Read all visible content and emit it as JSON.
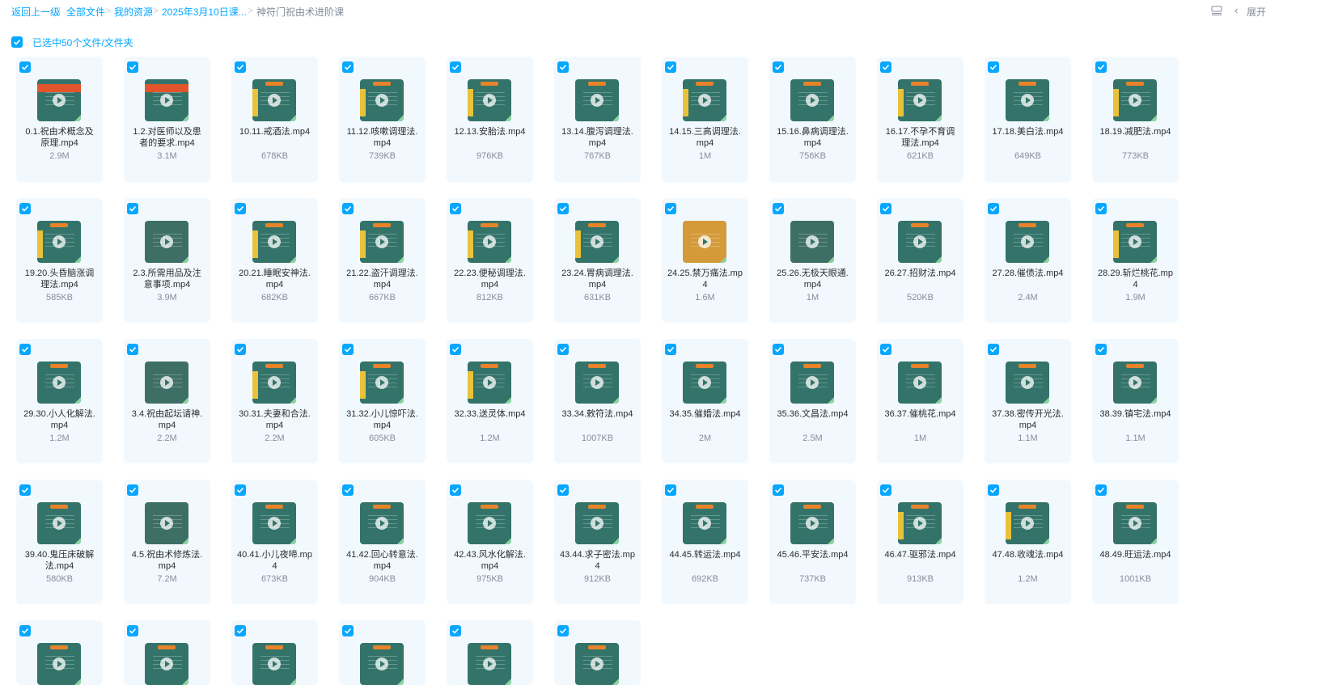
{
  "breadcrumb": {
    "back": "返回上一级",
    "items": [
      "全部文件",
      "我的资源",
      "2025年3月10日课...",
      "神符门祝由术进阶课"
    ]
  },
  "top_right": {
    "list_icon": "list-view-icon",
    "collapse": "展开"
  },
  "selection": {
    "label": "已选中50个文件/文件夹"
  },
  "accent_color": "#06a7ff",
  "files": [
    {
      "name": "0.1.祝由术概念及原理.mp4",
      "size": "2.9M",
      "thumb": "red"
    },
    {
      "name": "1.2.对医师以及患者的要求.mp4",
      "size": "3.1M",
      "thumb": "red"
    },
    {
      "name": "10.11.戒酒法.mp4",
      "size": "678KB",
      "thumb": "strip"
    },
    {
      "name": "11.12.咳嗽调理法.mp4",
      "size": "739KB",
      "thumb": "strip"
    },
    {
      "name": "12.13.安胎法.mp4",
      "size": "976KB",
      "thumb": "strip"
    },
    {
      "name": "13.14.腹泻调理法.mp4",
      "size": "767KB",
      "thumb": "plain"
    },
    {
      "name": "14.15.三高调理法.mp4",
      "size": "1M",
      "thumb": "strip"
    },
    {
      "name": "15.16.鼻病调理法.mp4",
      "size": "756KB",
      "thumb": "plain"
    },
    {
      "name": "16.17.不孕不育调理法.mp4",
      "size": "621KB",
      "thumb": "strip"
    },
    {
      "name": "17.18.美白法.mp4",
      "size": "649KB",
      "thumb": "plain"
    },
    {
      "name": "18.19.减肥法.mp4",
      "size": "773KB",
      "thumb": "strip"
    },
    {
      "name": "19.20.头昏脑涨调理法.mp4",
      "size": "585KB",
      "thumb": "strip"
    },
    {
      "name": "2.3.所需用品及注意事项.mp4",
      "size": "3.9M",
      "thumb": "ttl"
    },
    {
      "name": "20.21.睡眠安神法.mp4",
      "size": "682KB",
      "thumb": "strip"
    },
    {
      "name": "21.22.盗汗调理法.mp4",
      "size": "667KB",
      "thumb": "strip"
    },
    {
      "name": "22.23.便秘调理法.mp4",
      "size": "812KB",
      "thumb": "strip"
    },
    {
      "name": "23.24.胃病调理法.mp4",
      "size": "631KB",
      "thumb": "strip"
    },
    {
      "name": "24.25.禁万痛法.mp4",
      "size": "1.6M",
      "thumb": "pic"
    },
    {
      "name": "25.26.无极天眼通.mp4",
      "size": "1M",
      "thumb": "ttl"
    },
    {
      "name": "26.27.招财法.mp4",
      "size": "520KB",
      "thumb": "plain"
    },
    {
      "name": "27.28.催债法.mp4",
      "size": "2.4M",
      "thumb": "plain"
    },
    {
      "name": "28.29.斩烂桃花.mp4",
      "size": "1.9M",
      "thumb": "strip"
    },
    {
      "name": "29.30.小人化解法.mp4",
      "size": "1.2M",
      "thumb": "plain"
    },
    {
      "name": "3.4.祝由起坛请神.mp4",
      "size": "2.2M",
      "thumb": "ttl"
    },
    {
      "name": "30.31.夫妻和合法.mp4",
      "size": "2.2M",
      "thumb": "strip"
    },
    {
      "name": "31.32.小儿惊吓法.mp4",
      "size": "605KB",
      "thumb": "strip"
    },
    {
      "name": "32.33.送灵体.mp4",
      "size": "1.2M",
      "thumb": "strip"
    },
    {
      "name": "33.34.敕符法.mp4",
      "size": "1007KB",
      "thumb": "plain"
    },
    {
      "name": "34.35.催婚法.mp4",
      "size": "2M",
      "thumb": "plain"
    },
    {
      "name": "35.36.文昌法.mp4",
      "size": "2.5M",
      "thumb": "plain"
    },
    {
      "name": "36.37.催桃花.mp4",
      "size": "1M",
      "thumb": "plain"
    },
    {
      "name": "37.38.密传开光法.mp4",
      "size": "1.1M",
      "thumb": "plain"
    },
    {
      "name": "38.39.镇宅法.mp4",
      "size": "1.1M",
      "thumb": "plain"
    },
    {
      "name": "39.40.鬼压床破解法.mp4",
      "size": "580KB",
      "thumb": "plain"
    },
    {
      "name": "4.5.祝由术修炼法.mp4",
      "size": "7.2M",
      "thumb": "ttl"
    },
    {
      "name": "40.41.小儿夜啼.mp4",
      "size": "673KB",
      "thumb": "plain"
    },
    {
      "name": "41.42.回心转意法.mp4",
      "size": "904KB",
      "thumb": "plain"
    },
    {
      "name": "42.43.风水化解法.mp4",
      "size": "975KB",
      "thumb": "plain"
    },
    {
      "name": "43.44.求子密法.mp4",
      "size": "912KB",
      "thumb": "plain"
    },
    {
      "name": "44.45.转运法.mp4",
      "size": "692KB",
      "thumb": "plain"
    },
    {
      "name": "45.46.平安法.mp4",
      "size": "737KB",
      "thumb": "plain"
    },
    {
      "name": "46.47.驱邪法.mp4",
      "size": "913KB",
      "thumb": "strip"
    },
    {
      "name": "47.48.收魂法.mp4",
      "size": "1.2M",
      "thumb": "strip"
    },
    {
      "name": "48.49.旺运法.mp4",
      "size": "1001KB",
      "thumb": "plain"
    },
    {
      "name": "",
      "size": "",
      "thumb": "plain"
    },
    {
      "name": "",
      "size": "",
      "thumb": "plain"
    },
    {
      "name": "",
      "size": "",
      "thumb": "plain"
    },
    {
      "name": "",
      "size": "",
      "thumb": "plain"
    },
    {
      "name": "",
      "size": "",
      "thumb": "plain"
    },
    {
      "name": "",
      "size": "",
      "thumb": "plain"
    }
  ]
}
